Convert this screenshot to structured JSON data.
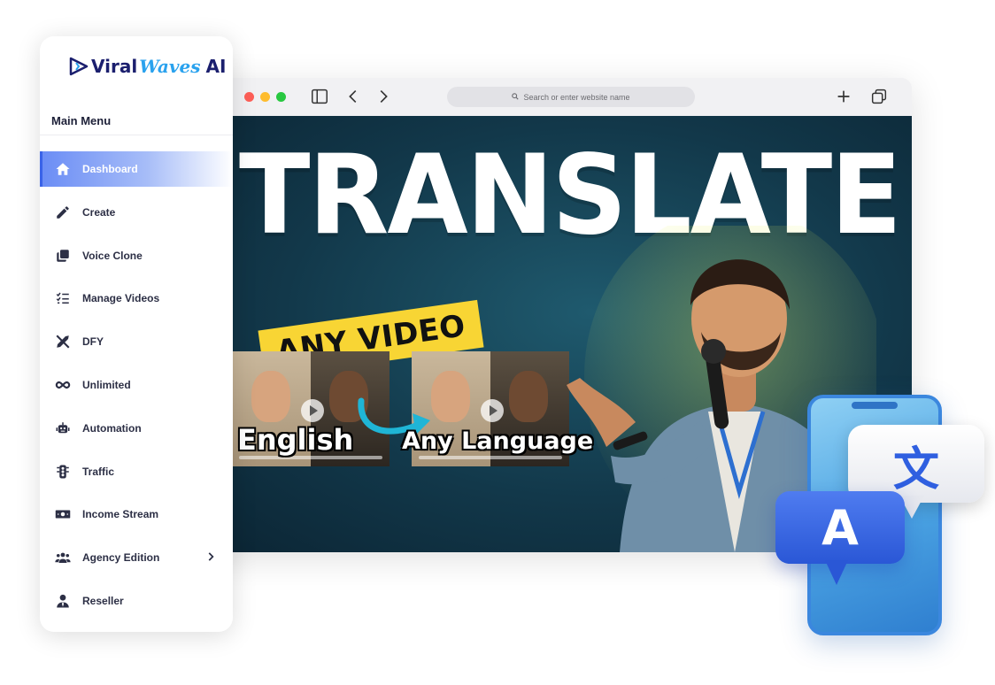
{
  "brand": {
    "word1": "Viral",
    "word2": "Waves",
    "word3": "AI"
  },
  "sidebar": {
    "menu_title": "Main Menu",
    "items": [
      {
        "label": "Dashboard",
        "icon": "home-icon"
      },
      {
        "label": "Create",
        "icon": "pencil-icon"
      },
      {
        "label": "Voice Clone",
        "icon": "clone-icon"
      },
      {
        "label": "Manage Videos",
        "icon": "list-check-icon"
      },
      {
        "label": "DFY",
        "icon": "tools-icon"
      },
      {
        "label": "Unlimited",
        "icon": "infinity-icon"
      },
      {
        "label": "Automation",
        "icon": "robot-icon"
      },
      {
        "label": "Traffic",
        "icon": "traffic-light-icon"
      },
      {
        "label": "Income Stream",
        "icon": "money-bill-icon"
      },
      {
        "label": "Agency Edition",
        "icon": "users-icon"
      },
      {
        "label": "Reseller",
        "icon": "user-tie-icon"
      }
    ],
    "active_item": "Dashboard"
  },
  "browser": {
    "address_placeholder": "Search or enter website name"
  },
  "hero": {
    "title": "TRANSLATE",
    "tag": "ANY VIDEO",
    "label_from": "English",
    "label_to": "Any Language"
  },
  "translate_badge": {
    "glyph_target": "文",
    "glyph_source": "A"
  },
  "colors": {
    "accent": "#3a63e8",
    "tag_yellow": "#f8d534",
    "hero_bg": "#12384a"
  }
}
